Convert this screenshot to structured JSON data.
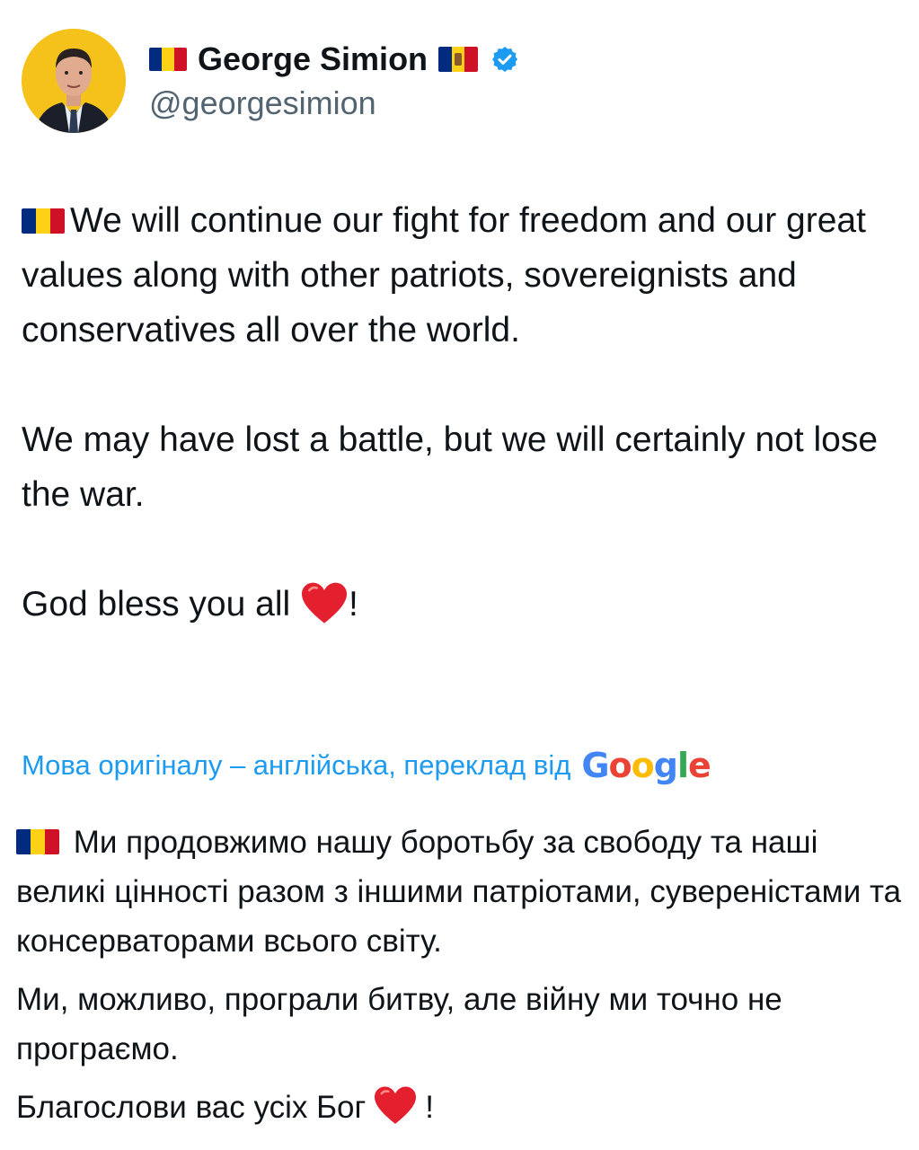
{
  "author": {
    "display_name": "George Simion",
    "handle": "@georgesimion",
    "verified": true,
    "avatar_icon": "profile-photo-avatar",
    "name_prefix_icon": "romania-flag-icon",
    "name_suffix_icon": "moldova-flag-icon"
  },
  "tweet": {
    "paragraph1": "We will continue our fight for freedom and our great values along with other patriots, sovereignists and conservatives all over the world.",
    "paragraph2": "We may have lost a battle, but we will certainly not lose the war.",
    "paragraph3_start": "God bless you all ",
    "paragraph3_end": "!"
  },
  "translation": {
    "label": "Мова оригіналу – англійська, переклад від",
    "provider": "Google",
    "paragraph1": " Ми продовжимо нашу боротьбу за свободу та наші великі цінності разом з іншими патріотами, сувереністами та консерваторами всього світу.",
    "paragraph2": "Ми, можливо, програли битву, але війну ми точно не програємо.",
    "paragraph3_start": "Благослови вас усіх Бог",
    "paragraph3_end": "!"
  },
  "colors": {
    "link_blue": "#1d9bf0",
    "text_primary": "#0f1419",
    "text_secondary": "#536471",
    "verified_blue": "#1d9bf0",
    "avatar_bg": "#f4c21a"
  },
  "icons": {
    "flag": "romania-flag-icon",
    "heart": "red-heart-icon",
    "verified": "verified-badge-icon"
  }
}
